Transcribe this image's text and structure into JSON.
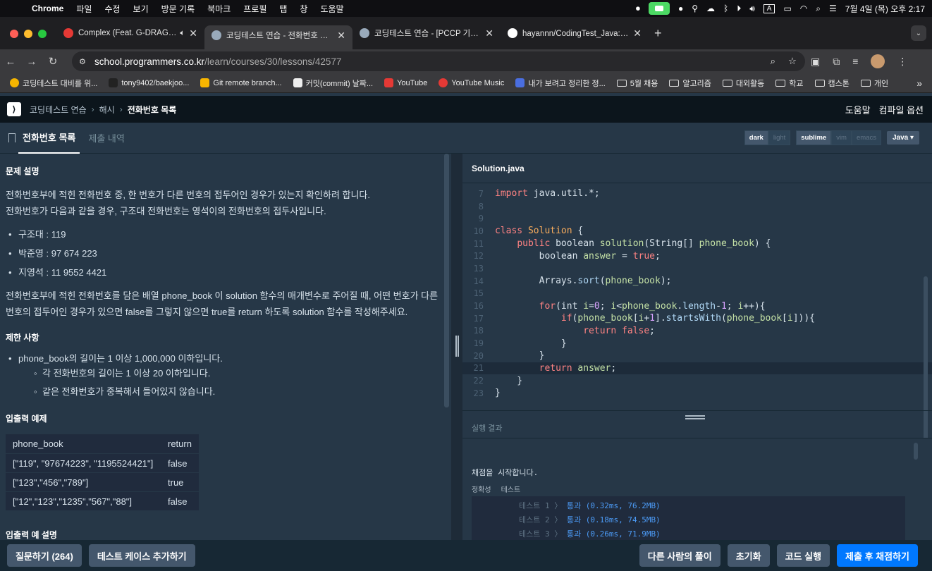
{
  "menubar": {
    "items": [
      "Chrome",
      "파일",
      "수정",
      "보기",
      "방문 기록",
      "북마크",
      "프로필",
      "탭",
      "창",
      "도움말"
    ],
    "datetime": "7월 4일 (목) 오후 2:17",
    "input_mode": "A"
  },
  "tabs": [
    {
      "title": "Complex (Feat. G-DRAGON)",
      "color": "#e53935"
    },
    {
      "title": "코딩테스트 연습 - 전화번호 목록 | 프로그래머스",
      "color": "#1a3a5c"
    },
    {
      "title": "코딩테스트 연습 - [PCCP 기출문제]",
      "color": "#1a3a5c"
    },
    {
      "title": "hayannn/CodingTest_Java: 백준",
      "color": "#111111"
    }
  ],
  "address": {
    "domain": "school.programmers.co.kr",
    "path": "/learn/courses/30/lessons/42577"
  },
  "bookmarks": [
    {
      "label": "코딩테스트 대비를 위...",
      "color": "#f4b400"
    },
    {
      "label": "tony9402/baekjoo...",
      "color": "#222"
    },
    {
      "label": "Git remote branch...",
      "color": "#f7b500"
    },
    {
      "label": "커밋(commit) 날짜...",
      "color": "#444"
    },
    {
      "label": "YouTube",
      "color": "#e53935"
    },
    {
      "label": "YouTube Music",
      "color": "#e53935"
    },
    {
      "label": "내가 보려고 정리한 정...",
      "color": "#4a6ee0"
    },
    {
      "label": "5월 채용",
      "folder": true
    },
    {
      "label": "알고리즘",
      "folder": true
    },
    {
      "label": "대외활동",
      "folder": true
    },
    {
      "label": "학교",
      "folder": true
    },
    {
      "label": "캡스톤",
      "folder": true
    },
    {
      "label": "개인",
      "folder": true
    }
  ],
  "header": {
    "crumbs": [
      "코딩테스트 연습",
      "해시",
      "전화번호 목록"
    ],
    "help": "도움말",
    "compile_options": "컴파일 옵션"
  },
  "subheader": {
    "tab_problem": "전화번호 목록",
    "tab_history": "제출 내역",
    "theme": [
      "dark",
      "light"
    ],
    "keymap": [
      "sublime",
      "vim",
      "emacs"
    ],
    "language": "Java ▾"
  },
  "problem": {
    "desc_title": "문제 설명",
    "desc_p1": "전화번호부에 적힌 전화번호 중, 한 번호가 다른 번호의 접두어인 경우가 있는지 확인하려 합니다.",
    "desc_p2": "전화번호가 다음과 같을 경우, 구조대 전화번호는 영석이의 전화번호의 접두사입니다.",
    "examples": [
      "구조대 : 119",
      "박준영 : 97 674 223",
      "지영석 : 11 9552 4421"
    ],
    "desc_p3": "전화번호부에 적힌 전화번호를 담은 배열 phone_book 이 solution 함수의 매개변수로 주어질 때, 어떤 번호가 다른",
    "desc_p4": "번호의 접두어인 경우가 있으면 false를 그렇지 않으면 true를 return 하도록 solution 함수를 작성해주세요.",
    "limit_title": "제한 사항",
    "limit_main": "phone_book의 길이는 1 이상 1,000,000 이하입니다.",
    "limit_subs": [
      "각 전화번호의 길이는 1 이상 20 이하입니다.",
      "같은 전화번호가 중복해서 들어있지 않습니다."
    ],
    "io_title": "입출력 예제",
    "io_headers": [
      "phone_book",
      "return"
    ],
    "io_rows": [
      [
        "[\"119\", \"97674223\", \"1195524421\"]",
        "false"
      ],
      [
        "[\"123\",\"456\",\"789\"]",
        "true"
      ],
      [
        "[\"12\",\"123\",\"1235\",\"567\",\"88\"]",
        "false"
      ]
    ],
    "io_explain_title": "입출력 예 설명"
  },
  "editor": {
    "filename": "Solution.java",
    "line_numbers": [
      "7",
      "8",
      "9",
      "10",
      "11",
      "12",
      "13",
      "14",
      "15",
      "16",
      "17",
      "18",
      "19",
      "20",
      "21",
      "22",
      "23"
    ],
    "current_line": "21"
  },
  "result": {
    "title": "실행 결과",
    "start": "채점을 시작합니다.",
    "tabs": [
      "정확성",
      "테스트"
    ],
    "tests": [
      {
        "label": "테스트 1 〉",
        "result": "통과 (0.32ms, 76.2MB)"
      },
      {
        "label": "테스트 2 〉",
        "result": "통과 (0.18ms, 74.5MB)"
      },
      {
        "label": "테스트 3 〉",
        "result": "통과 (0.26ms, 71.9MB)"
      }
    ]
  },
  "bottom": {
    "ask": "질문하기 (264)",
    "add_test": "테스트 케이스 추가하기",
    "others": "다른 사람의 풀이",
    "reset": "초기화",
    "run": "코드 실행",
    "submit": "제출 후 채점하기"
  }
}
